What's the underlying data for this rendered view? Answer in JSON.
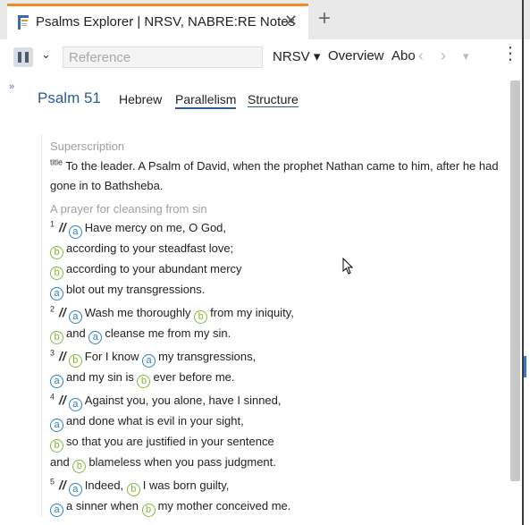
{
  "tab": {
    "title": "Psalms Explorer | NRSV, NABRE:RE Notes",
    "close": "✕",
    "new": "+"
  },
  "toolbar": {
    "search_placeholder": "Reference",
    "version": "NRSV ▾",
    "overview": "Overview",
    "about": "Abo",
    "back": "‹",
    "forward": "›",
    "dropdown": "▾",
    "menu": "⋮"
  },
  "collapse": "»",
  "header": {
    "title": "Psalm 51",
    "links": [
      "Hebrew",
      "Parallelism",
      "Structure"
    ]
  },
  "superscription": {
    "heading": "Superscription",
    "label": "title",
    "text": "To the leader. A Psalm of David, when the prophet Nathan came to him, after he had gone in to Bathsheba."
  },
  "section": {
    "heading": "A prayer for cleansing from sin"
  },
  "verses": [
    {
      "num": "1",
      "lines": [
        [
          [
            "a",
            "Have mercy on me, O God,"
          ]
        ],
        [
          [
            "b",
            "according to your steadfast love;"
          ]
        ],
        [
          [
            "b",
            "according to your abundant mercy"
          ]
        ],
        [
          [
            "a",
            "blot out my transgressions."
          ]
        ]
      ]
    },
    {
      "num": "2",
      "lines": [
        [
          [
            "a",
            "Wash me thoroughly "
          ],
          [
            "b",
            "from my iniquity,"
          ]
        ],
        [
          [
            "b",
            "and "
          ],
          [
            "a",
            "cleanse me from my sin."
          ]
        ]
      ]
    },
    {
      "num": "3",
      "lines": [
        [
          [
            "b",
            "For I know "
          ],
          [
            "a",
            "my transgressions,"
          ]
        ],
        [
          [
            "a",
            "and my sin is "
          ],
          [
            "b",
            "ever before me."
          ]
        ]
      ]
    },
    {
      "num": "4",
      "lines": [
        [
          [
            "a",
            "Against you, you alone, have I sinned,"
          ]
        ],
        [
          [
            "a",
            "and done what is evil in your sight,"
          ]
        ],
        [
          [
            "b",
            "so that you are justified in your sentence"
          ]
        ],
        [
          [
            "",
            "and "
          ],
          [
            "b",
            "blameless when you pass judgment."
          ]
        ]
      ]
    },
    {
      "num": "5",
      "lines": [
        [
          [
            "a",
            "Indeed, "
          ],
          [
            "b",
            "I was born guilty,"
          ]
        ],
        [
          [
            "a",
            "a sinner when "
          ],
          [
            "b",
            "my mother conceived me."
          ]
        ]
      ]
    }
  ],
  "colors": {
    "a": "#2f7fbf",
    "b": "#86b83a",
    "accent": "#f08a24",
    "title": "#2b5d8f"
  }
}
